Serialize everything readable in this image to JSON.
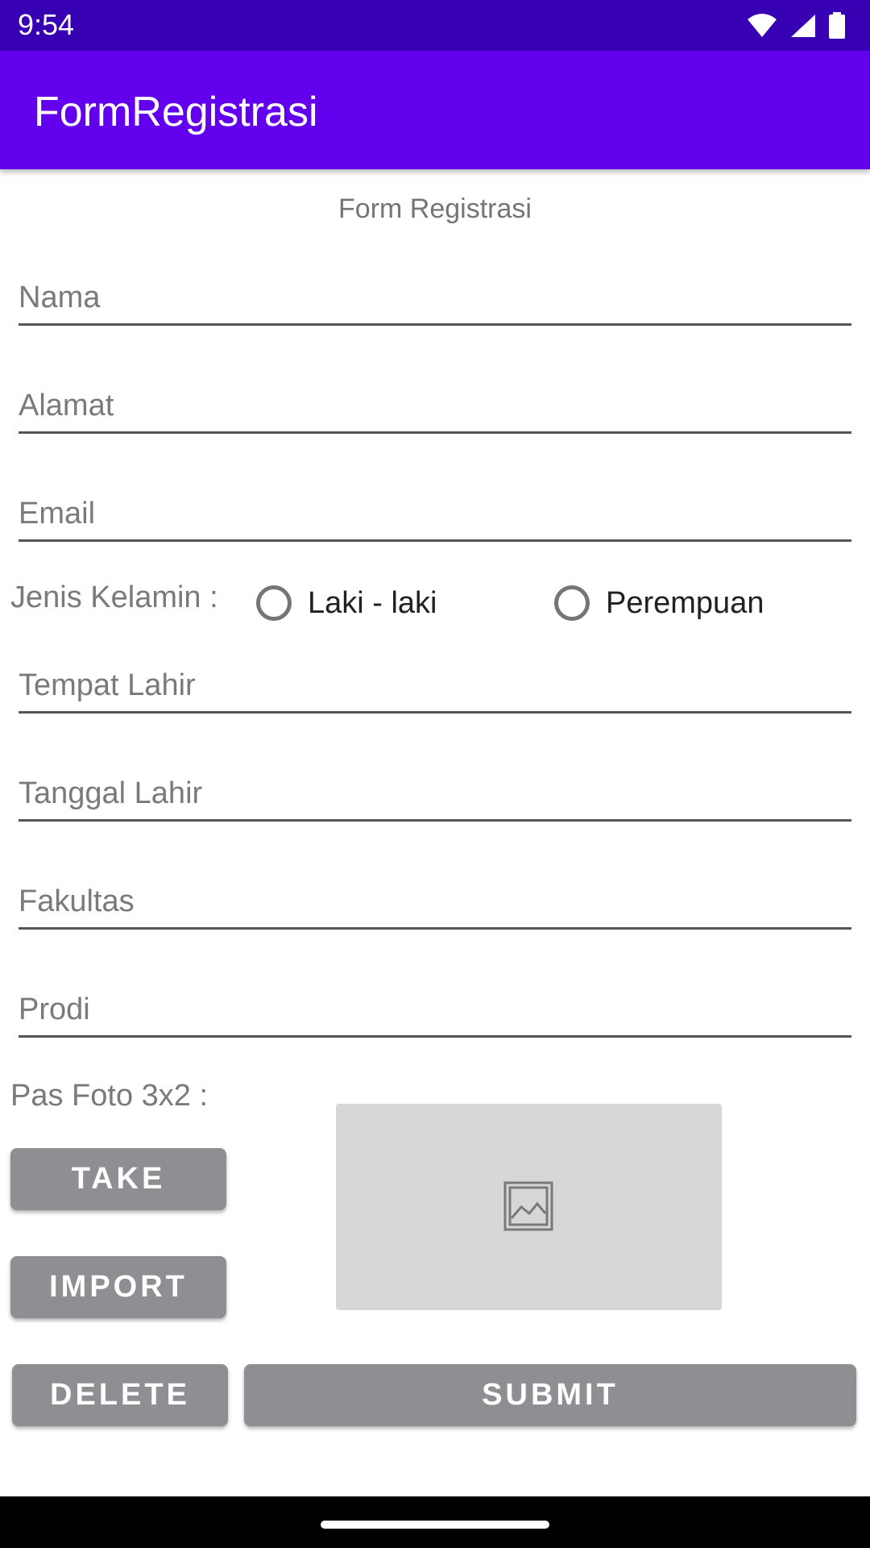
{
  "status": {
    "time": "9:54"
  },
  "app_bar": {
    "title": "FormRegistrasi"
  },
  "form": {
    "heading": "Form Registrasi",
    "fields": {
      "nama": "Nama",
      "alamat": "Alamat",
      "email": "Email",
      "tempat_lahir": "Tempat Lahir",
      "tanggal_lahir": "Tanggal Lahir",
      "fakultas": "Fakultas",
      "prodi": "Prodi"
    },
    "gender": {
      "label": "Jenis Kelamin :",
      "options": [
        "Laki - laki",
        "Perempuan"
      ]
    },
    "photo": {
      "label": "Pas Foto 3x2 :",
      "take_label": "TAKE",
      "import_label": "IMPORT",
      "placeholder_icon": "image-placeholder-icon"
    },
    "buttons": {
      "delete": "DELETE",
      "submit": "SUBMIT"
    }
  },
  "colors": {
    "status_bar": "#3700B3",
    "app_bar": "#6200EE",
    "button": "#8e8e93",
    "photo_bg": "#d6d7d7"
  }
}
